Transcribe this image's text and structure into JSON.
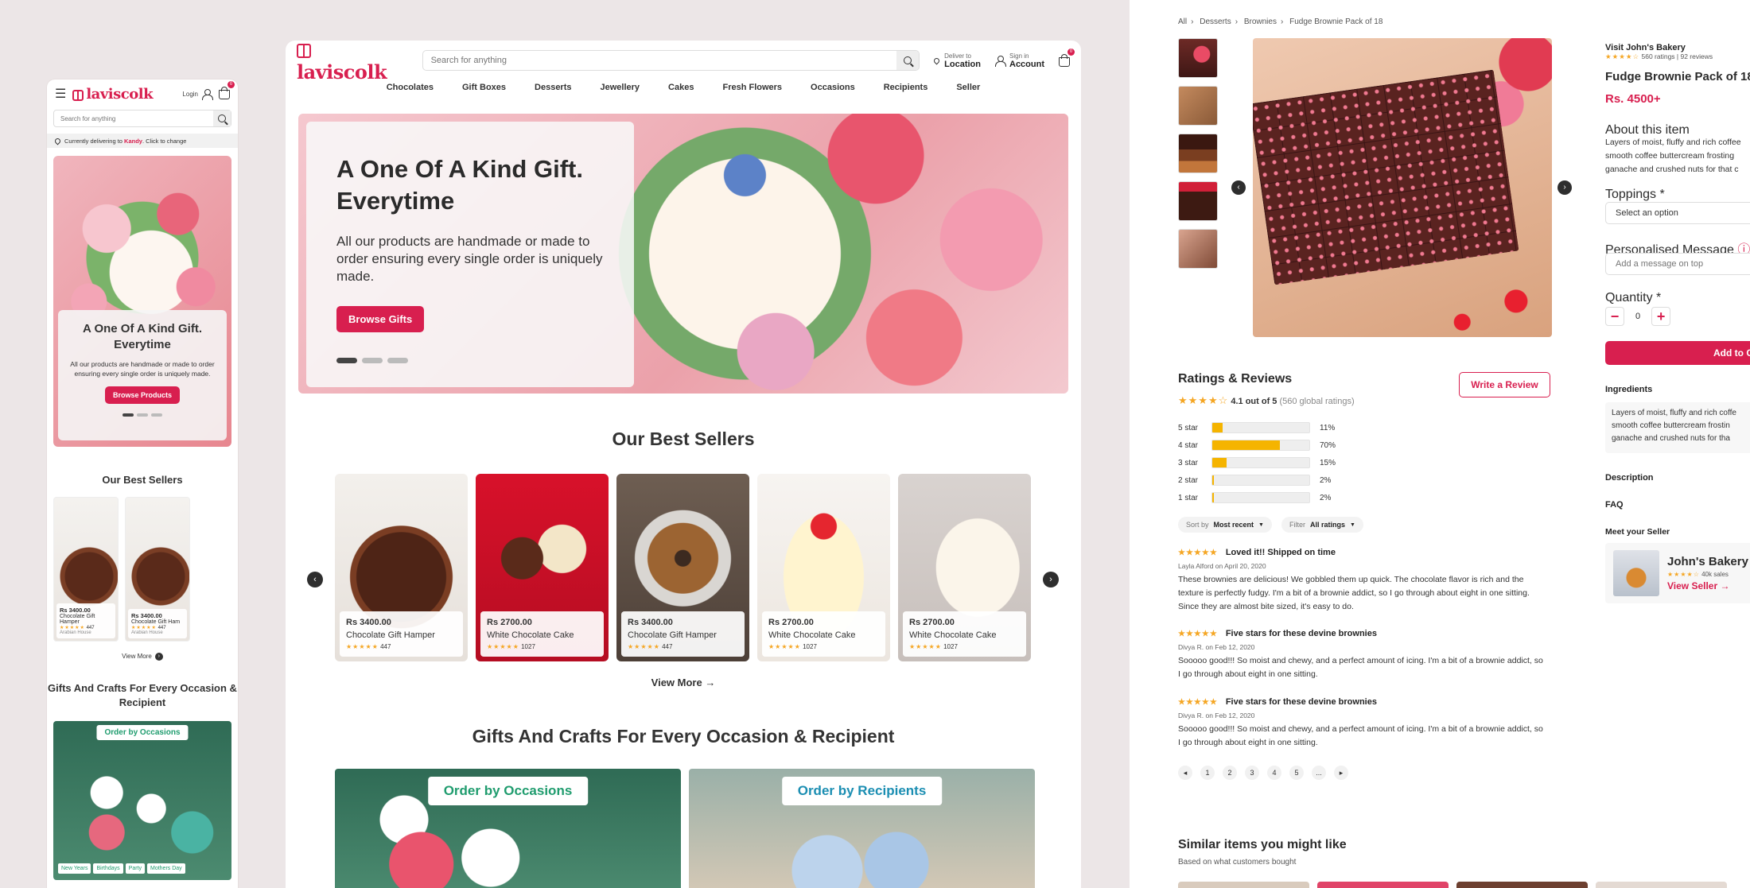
{
  "brand": "laviscolk",
  "mobile": {
    "login": "Login",
    "cart_count": "0",
    "search_placeholder": "Search for anything",
    "deliver_prefix": "Currently delivering to",
    "deliver_city": "Kandy",
    "deliver_suffix": ". Click to change",
    "hero_title": "A One Of A Kind Gift. Everytime",
    "hero_text": "All our products are handmade or made to order ensuring every single order is uniquely made.",
    "hero_button": "Browse Products",
    "best_sellers": "Our Best Sellers",
    "products": [
      {
        "price": "Rs 3400.00",
        "name": "Chocolate Gift Hamper",
        "rating": "★★★★★",
        "count": "447",
        "seller": "Arabian House"
      },
      {
        "price": "Rs 3400.00",
        "name": "Chocolate Gift Ham",
        "rating": "★★★★★",
        "count": "447",
        "seller": "Arabian House"
      }
    ],
    "view_more": "View More",
    "gifts_title": "Gifts And Crafts For Every Occasion & Recipient",
    "occasions_tag": "Order by Occasions",
    "chips": [
      "New Years",
      "Birthdays",
      "Party",
      "Mothers Day"
    ]
  },
  "desktop": {
    "search_placeholder": "Search for anything",
    "deliver_top": "Deliver to",
    "deliver_bottom": "Location",
    "signin_top": "Sign in",
    "signin_bottom": "Account",
    "cart_count": "0",
    "nav": [
      "Chocolates",
      "Gift Boxes",
      "Desserts",
      "Jewellery",
      "Cakes",
      "Fresh Flowers",
      "Occasions",
      "Recipients",
      "Seller"
    ],
    "hero_title": "A One Of A Kind Gift. Everytime",
    "hero_text": "All our products are handmade or made to order ensuring every single order is uniquely made.",
    "hero_button": "Browse Gifts",
    "best_sellers": "Our Best Sellers",
    "products": [
      {
        "price": "Rs 3400.00",
        "name": "Chocolate Gift Hamper",
        "rating": "★★★★★",
        "count": "447"
      },
      {
        "price": "Rs 2700.00",
        "name": "White Chocolate Cake",
        "rating": "★★★★★",
        "count": "1027"
      },
      {
        "price": "Rs 3400.00",
        "name": "Chocolate Gift Hamper",
        "rating": "★★★★★",
        "count": "447"
      },
      {
        "price": "Rs 2700.00",
        "name": "White Chocolate Cake",
        "rating": "★★★★★",
        "count": "1027"
      },
      {
        "price": "Rs 2700.00",
        "name": "White Chocolate Cake",
        "rating": "★★★★★",
        "count": "1027"
      }
    ],
    "view_more": "View More",
    "gifts_title": "Gifts And Crafts For Every Occasion & Recipient",
    "occasions_tag": "Order by Occasions",
    "recipients_tag": "Order by Recipients"
  },
  "detail": {
    "breadcrumb": [
      "All",
      "Desserts",
      "Brownies",
      "Fudge Brownie Pack of 18"
    ],
    "reviews_title": "Ratings & Reviews",
    "summary_stars": "★★★★☆",
    "summary_score": "4.1 out of 5",
    "summary_count": "(560 global ratings)",
    "write_review": "Write a Review",
    "rating_bars": [
      {
        "label": "5 star",
        "pct": 11,
        "pct_text": "11%"
      },
      {
        "label": "4 star",
        "pct": 70,
        "pct_text": "70%"
      },
      {
        "label": "3 star",
        "pct": 15,
        "pct_text": "15%"
      },
      {
        "label": "2 star",
        "pct": 2,
        "pct_text": "2%"
      },
      {
        "label": "1 star",
        "pct": 2,
        "pct_text": "2%"
      }
    ],
    "sort_label": "Sort by",
    "sort_value": "Most recent",
    "filter_label": "Filter",
    "filter_value": "All ratings",
    "reviews": [
      {
        "stars": "★★★★★",
        "title": "Loved it!! Shipped on time",
        "by": "Layla Alford on April 20, 2020",
        "text": "These brownies are delicious! We gobbled them up quick. The chocolate flavor is rich and the texture is perfectly fudgy. I'm a bit of a brownie addict, so I go through about eight in one sitting. Since they are almost bite sized, it's easy to do."
      },
      {
        "stars": "★★★★★",
        "title": "Five stars for these devine brownies",
        "by": "Divya R. on Feb 12, 2020",
        "text": "Sooooo good!!! So moist and chewy, and a perfect amount of icing. I'm a bit of a brownie addict, so I go through about eight in one sitting."
      },
      {
        "stars": "★★★★★",
        "title": "Five stars for these devine brownies",
        "by": "Divya R. on Feb 12, 2020",
        "text": "Sooooo good!!! So moist and chewy, and a perfect amount of icing. I'm a bit of a brownie addict, so I go through about eight in one sitting."
      }
    ],
    "pages": [
      "◂",
      "1",
      "2",
      "3",
      "4",
      "5",
      "...",
      "▸"
    ],
    "similar_title": "Similar items you might like",
    "similar_sub": "Based on what customers bought",
    "seller_link": "Visit John's Bakery",
    "top_stars": "★★★★☆",
    "top_ratings": "560 ratings",
    "top_reviews": "92 reviews",
    "product_title": "Fudge Brownie Pack of 18",
    "price": "Rs. 4500+",
    "about_label": "About this item",
    "about_text": "Layers of moist, fluffy and rich coffee smooth coffee buttercream frosting ganache and crushed nuts for that c",
    "toppings_label": "Toppings",
    "toppings_value": "Select an option",
    "message_label": "Personalised Message",
    "message_placeholder": "Add a message on top",
    "quantity_label": "Quantity",
    "quantity_value": "0",
    "add_button": "Add to C",
    "ingredients_label": "Ingredients",
    "ingredients_text": "Layers of moist, fluffy and rich coffe smooth coffee buttercream frostin ganache and crushed nuts for tha",
    "description_label": "Description",
    "faq_label": "FAQ",
    "meet_seller": "Meet your Seller",
    "seller_name": "John's Bakery",
    "seller_stars": "★★★★☆",
    "seller_sales": "40k sales",
    "view_seller": "View Seller"
  }
}
